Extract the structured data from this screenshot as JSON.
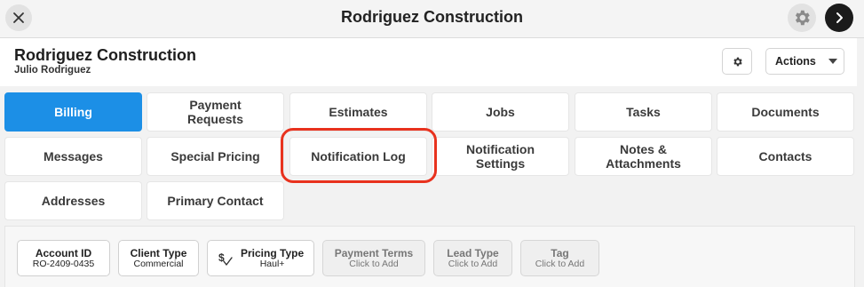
{
  "window": {
    "title": "Rodriguez Construction"
  },
  "header": {
    "client_name": "Rodriguez Construction",
    "contact_name": "Julio Rodriguez",
    "actions_label": "Actions"
  },
  "tabs": [
    {
      "label": "Billing",
      "active": true
    },
    {
      "label": "Payment\nRequests"
    },
    {
      "label": "Estimates"
    },
    {
      "label": "Jobs"
    },
    {
      "label": "Tasks"
    },
    {
      "label": "Documents"
    },
    {
      "label": "Messages"
    },
    {
      "label": "Special Pricing"
    },
    {
      "label": "Notification Log",
      "highlighted": true
    },
    {
      "label": "Notification\nSettings"
    },
    {
      "label": "Notes &\nAttachments"
    },
    {
      "label": "Contacts"
    },
    {
      "label": "Addresses"
    },
    {
      "label": "Primary Contact"
    }
  ],
  "info": {
    "account_id": {
      "label": "Account ID",
      "value": "RO-2409-0435"
    },
    "client_type": {
      "label": "Client Type",
      "value": "Commercial"
    },
    "pricing_type": {
      "label": "Pricing Type",
      "value": "Haul+"
    },
    "payment_terms": {
      "label": "Payment Terms",
      "value": "Click to Add"
    },
    "lead_type": {
      "label": "Lead Type",
      "value": "Click to Add"
    },
    "tag": {
      "label": "Tag",
      "value": "Click to Add"
    }
  },
  "colors": {
    "accent": "#1c8fe6",
    "highlight": "#e8321e"
  },
  "icons": {
    "close": "close-icon",
    "gear": "gear-icon",
    "next": "chevron-right-icon",
    "pricing": "pricing-tag-icon"
  }
}
